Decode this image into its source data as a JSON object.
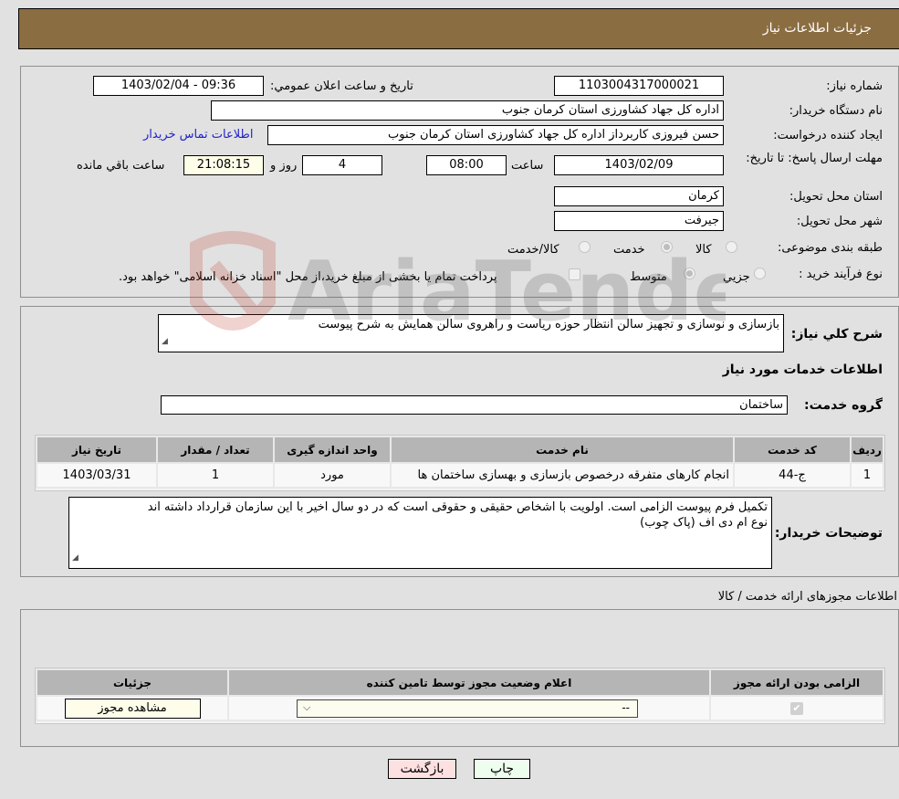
{
  "header": {
    "title": "جزئیات اطلاعات نیاز"
  },
  "form": {
    "need_number_label": "شماره نیاز:",
    "need_number": "1103004317000021",
    "announce_label": "تاریخ و ساعت اعلان عمومي:",
    "announce_value": "1403/02/04 - 09:36",
    "buyer_org_label": "نام دستگاه خریدار:",
    "buyer_org": "اداره کل جهاد کشاورزی استان کرمان   جنوب",
    "creator_label": "ایجاد کننده درخواست:",
    "creator": "حسن فیروزی کاربرداز اداره کل جهاد کشاورزی استان کرمان   جنوب",
    "contact_link": "اطلاعات تماس خریدار",
    "deadline_label": "مهلت ارسال پاسخ: تا تاریخ:",
    "deadline_date": "1403/02/09",
    "time_label": "ساعت",
    "deadline_time": "08:00",
    "days_value": "4",
    "days_label": "روز و",
    "remaining_time": "21:08:15",
    "remaining_label": "ساعت باقي مانده",
    "province_label": "استان محل تحویل:",
    "province": "کرمان",
    "city_label": "شهر محل تحویل:",
    "city": "جیرفت",
    "category_label": "طبقه بندی موضوعی:",
    "category_options": [
      "کالا",
      "خدمت",
      "کالا/خدمت"
    ],
    "category_selected": "خدمت",
    "process_label": "نوع فرآیند خرید :",
    "process_options": [
      "جزیي",
      "متوسط"
    ],
    "process_selected": "متوسط",
    "treasury_note": "پرداخت تمام یا بخشی از مبلغ خرید،از محل \"اسناد خزانه اسلامی\" خواهد بود."
  },
  "details": {
    "description_label": "شرح کلي نیاز:",
    "description": "بازسازی و نوسازی و تجهیز سالن انتظار حوزه ریاست و راهروی سالن همایش به شرح پیوست",
    "services_heading": "اطلاعات خدمات مورد نیاز",
    "service_group_label": "گروه خدمت:",
    "service_group": "ساختمان",
    "services_table": {
      "headers": [
        "ردیف",
        "کد خدمت",
        "نام خدمت",
        "واحد اندازه گیری",
        "تعداد / مقدار",
        "تاریخ نیاز"
      ],
      "rows": [
        [
          "1",
          "ج-44",
          "انجام کارهای متفرقه درخصوص بازسازی و بهسازی ساختمان ها",
          "مورد",
          "1",
          "1403/03/31"
        ]
      ]
    },
    "buyer_notes_label": "توضیحات خریدار:",
    "buyer_notes_line1": "تکمیل فرم پیوست الزامی است. اولویت با اشخاص حقیقی و حقوقی است که در دو سال اخیر با این سازمان قرارداد داشته اند",
    "buyer_notes_line2": "نوع ام دی اف (پاک چوب)"
  },
  "permits": {
    "heading": "اطلاعات مجوزهای ارائه خدمت / کالا",
    "headers": [
      "الزامی بودن ارائه مجوز",
      "اعلام وضعیت مجوز توسط تامین کننده",
      "جزئیات"
    ],
    "select_value": "--",
    "view_button": "مشاهده مجوز"
  },
  "footer": {
    "print_button": "چاپ",
    "back_button": "بازگشت"
  },
  "watermark_text": "AriaTender.neT"
}
